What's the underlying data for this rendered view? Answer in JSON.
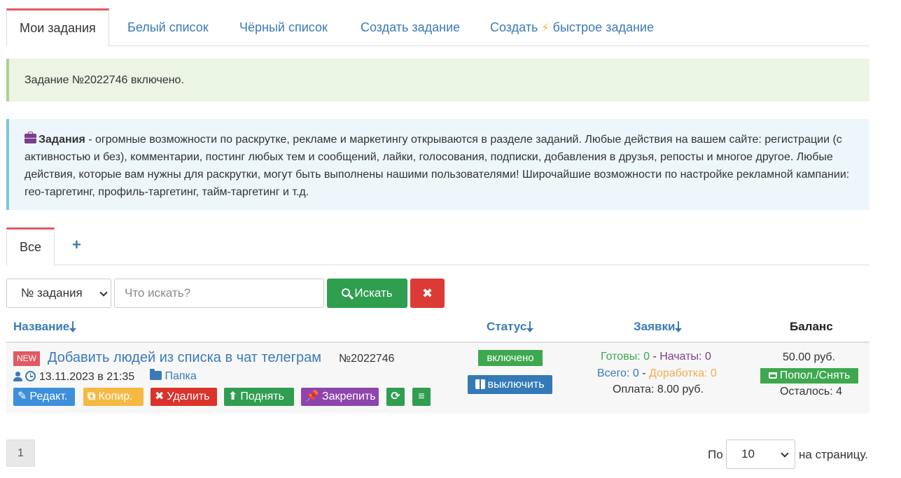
{
  "tabs": [
    {
      "label": "Мои задания",
      "active": true
    },
    {
      "label": "Белый список"
    },
    {
      "label": "Чёрный список"
    },
    {
      "label": "Создать задание"
    },
    {
      "label_pre": "Создать",
      "icon": "bolt-icon",
      "label_post": "быстрое задание"
    }
  ],
  "alert_success": "Задание №2022746 включено.",
  "info": {
    "title": "Задания",
    "text": " - огромные возможности по раскрутке, рекламе и маркетингу открываются в разделе заданий. Любые действия на вашем сайте: регистрации (с активностью и без), комментарии, постинг любых тем и сообщений, лайки, голосования, подписки, добавления в друзья, репосты и многое другое. Любые действия, которые вам нужны для раскрутки, могут быть выполнены нашими пользователями! Широчайшие возможности по настройке рекламной кампании: гео-таргетинг, профиль-таргетинг, тайм-таргетинг и т.д."
  },
  "subtabs": {
    "all": "Все",
    "add": "+"
  },
  "search": {
    "field_selected": "№ задания",
    "placeholder": "Что искать?",
    "button": "Искать",
    "clear": "✖"
  },
  "table": {
    "headers": {
      "name": "Название",
      "status": "Статус",
      "requests": "Заявки",
      "balance": "Баланс"
    },
    "row": {
      "badge": "NEW",
      "title": "Добавить людей из списка в чат телеграм",
      "number": "№2022746",
      "date": "13.11.2023 в 21:35",
      "folder": "Папка",
      "actions": {
        "edit": "Редакт.",
        "copy": "Копир.",
        "delete": "Удалить",
        "raise": "Поднять",
        "pin": "Закрепить"
      },
      "status": "включено",
      "disable": "выключить",
      "requests": {
        "ready_label": "Готовы:",
        "ready": "0",
        "started_label": "Начаты:",
        "started": "0",
        "total_label": "Всего:",
        "total": "0",
        "rework_label": "Доработка:",
        "rework": "0",
        "payment": "Оплата: 8.00 руб."
      },
      "balance": "50.00 руб.",
      "topup": "Попол./Снять",
      "remaining": "Осталось: 4"
    }
  },
  "pagination": {
    "page": "1",
    "per_prefix": "По",
    "per_value": "10",
    "per_suffix": "на страницу."
  },
  "colors": {
    "accent": "#3a7ab8",
    "success": "#3ea84f",
    "danger": "#dc3b35",
    "warning": "#f0ad2e",
    "purple": "#8e44ad",
    "tab_top": "#e05a63"
  }
}
